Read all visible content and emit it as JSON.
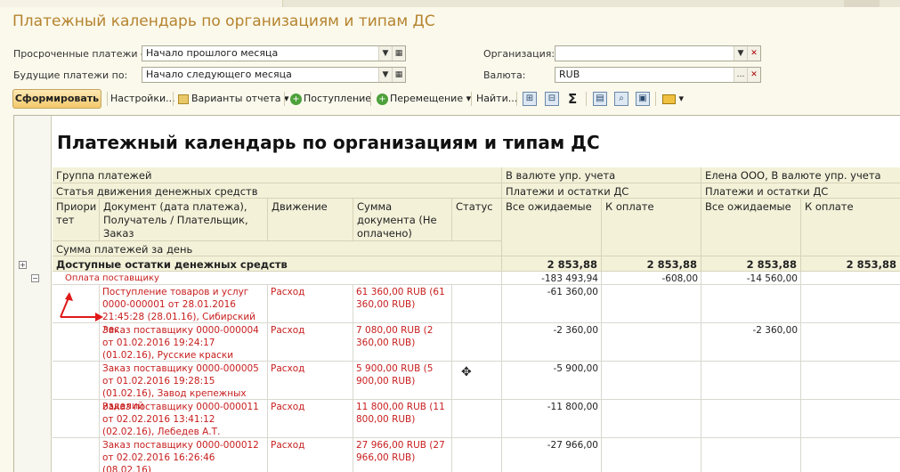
{
  "window": {
    "title": "Платежный календарь по организациям и типам ДС"
  },
  "filters": {
    "overdue_label": "Просроченные платежи с:",
    "overdue_value": "Начало прошлого месяца",
    "future_label": "Будущие платежи по:",
    "future_value": "Начало следующего месяца",
    "org_label": "Организация:",
    "org_value": "",
    "currency_label": "Валюта:",
    "currency_value": "RUB"
  },
  "toolbar": {
    "generate": "Сформировать",
    "settings": "Настройки...",
    "variants": "Варианты отчета",
    "income": "Поступление",
    "move": "Перемещение",
    "find": "Найти...",
    "sigma": "Σ"
  },
  "report": {
    "title": "Платежный календарь по организациям и типам ДС",
    "headers": {
      "group": "Группа платежей",
      "article": "Статья движения денежных средств",
      "priority": "Приори тет",
      "document": "Документ (дата платежа), Получатель / Плательщик, Заказ",
      "movement": "Движение",
      "sum": "Сумма документа (Не оплачено)",
      "status": "Статус",
      "daily": "Сумма платежей за день",
      "curr_mgmt": "В валюте упр. учета",
      "org_mgmt": "Елена ООО, В валюте упр. учета",
      "payments_balances": "Платежи и остатки ДС",
      "all_expected": "Все ожидаемые",
      "to_pay": "К оплате"
    },
    "available": {
      "label": "Доступные остатки денежных средств",
      "v1": "2 853,88",
      "v2": "2 853,88",
      "v3": "2 853,88",
      "v4": "2 853,88"
    },
    "supplier": {
      "label": "Оплата поставщику",
      "v1": "-183 493,94",
      "v2": "-608,00",
      "v3": "-14 560,00",
      "v4": ""
    },
    "rows": [
      {
        "doc": "Поступление товаров и услуг 0000-000001 от 28.01.2016 21:45:28 (28.01.16), Сибирский лес",
        "mv": "Расход",
        "sum": "61 360,00 RUB (61 360,00 RUB)",
        "v1": "-61 360,00",
        "v2": "",
        "v3": "",
        "v4": ""
      },
      {
        "doc": "Заказ поставщику 0000-000004 от 01.02.2016 19:24:17 (01.02.16), Русские краски",
        "mv": "Расход",
        "sum": "7 080,00 RUB (2 360,00 RUB)",
        "v1": "-2 360,00",
        "v2": "",
        "v3": "-2 360,00",
        "v4": ""
      },
      {
        "doc": "Заказ поставщику 0000-000005 от 01.02.2016 19:28:15 (01.02.16), Завод крепежных изделий",
        "mv": "Расход",
        "sum": "5 900,00 RUB (5 900,00 RUB)",
        "v1": "-5 900,00",
        "v2": "",
        "v3": "",
        "v4": ""
      },
      {
        "doc": "Заказ поставщику 0000-000011 от 02.02.2016 13:41:12 (02.02.16), Лебедев А.Т.",
        "mv": "Расход",
        "sum": "11 800,00 RUB (11 800,00 RUB)",
        "v1": "-11 800,00",
        "v2": "",
        "v3": "",
        "v4": ""
      },
      {
        "doc": "Заказ поставщику 0000-000012 от 02.02.2016 16:26:46 (08.02.16)",
        "mv": "Расход",
        "sum": "27 966,00 RUB (27 966,00 RUB)",
        "v1": "-27 966,00",
        "v2": "",
        "v3": "",
        "v4": ""
      }
    ]
  }
}
